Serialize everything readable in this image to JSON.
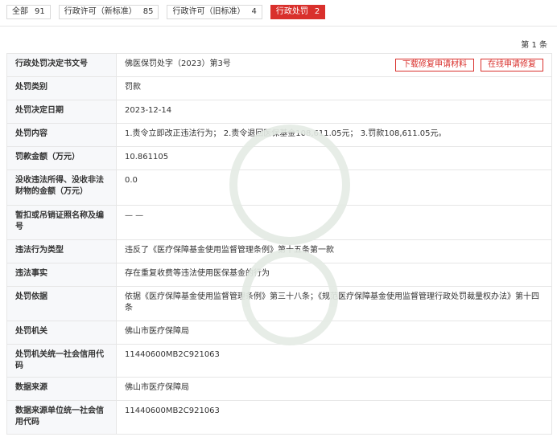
{
  "tabs": [
    {
      "label": "全部",
      "count": "91",
      "active": false
    },
    {
      "label": "行政许可（新标准）",
      "count": "85",
      "active": false
    },
    {
      "label": "行政许可（旧标准）",
      "count": "4",
      "active": false
    },
    {
      "label": "行政处罚",
      "count": "2",
      "active": true
    }
  ],
  "page_info": "第 1 条",
  "buttons": {
    "download": "下载修复申请材料",
    "online": "在线申请修复"
  },
  "rows": [
    {
      "label": "行政处罚决定书文号",
      "value": "佛医保罚处字（2023）第3号"
    },
    {
      "label": "处罚类别",
      "value": "罚款"
    },
    {
      "label": "处罚决定日期",
      "value": "2023-12-14"
    },
    {
      "label": "处罚内容",
      "value": "1.责令立即改正违法行为； 2.责令退回医保基金108,611.05元； 3.罚款108,611.05元。"
    },
    {
      "label": "罚款金额（万元）",
      "value": "10.861105"
    },
    {
      "label": "没收违法所得、没收非法财物的金额（万元）",
      "value": "0.0"
    },
    {
      "label": "暂扣或吊销证照名称及编号",
      "value": "— —"
    },
    {
      "label": "违法行为类型",
      "value": "违反了《医疗保障基金使用监督管理条例》第十五条第一款"
    },
    {
      "label": "违法事实",
      "value": "存在重复收费等违法使用医保基金的行为"
    },
    {
      "label": "处罚依据",
      "value": "依据《医疗保障基金使用监督管理条例》第三十八条；《规范医疗保障基金使用监督管理行政处罚裁量权办法》第十四条"
    },
    {
      "label": "处罚机关",
      "value": "佛山市医疗保障局"
    },
    {
      "label": "处罚机关统一社会信用代码",
      "value": "11440600MB2C921063"
    },
    {
      "label": "数据来源",
      "value": "佛山市医疗保障局"
    },
    {
      "label": "数据来源单位统一社会信用代码",
      "value": "11440600MB2C921063"
    }
  ]
}
